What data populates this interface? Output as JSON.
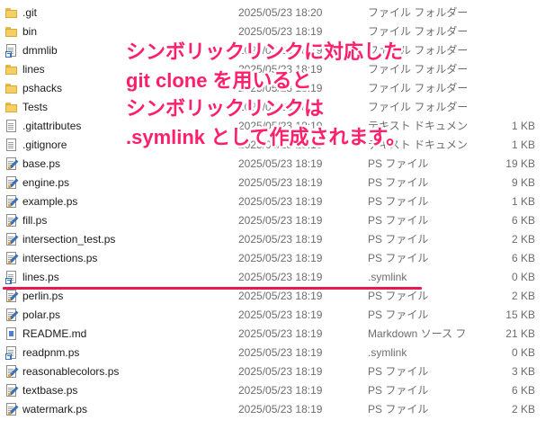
{
  "files": [
    {
      "name": ".git",
      "date": "2025/05/23 18:20",
      "type": "ファイル フォルダー",
      "size": "",
      "icon": "folder-icon"
    },
    {
      "name": "bin",
      "date": "2025/05/23 18:19",
      "type": "ファイル フォルダー",
      "size": "",
      "icon": "folder-icon"
    },
    {
      "name": "dmmlib",
      "date": "2025/05/23 18:19",
      "type": "ファイル フォルダー",
      "size": "",
      "icon": "symlink-file-icon"
    },
    {
      "name": "lines",
      "date": "2025/05/23 18:19",
      "type": "ファイル フォルダー",
      "size": "",
      "icon": "folder-icon"
    },
    {
      "name": "pshacks",
      "date": "2025/05/23 18:19",
      "type": "ファイル フォルダー",
      "size": "",
      "icon": "folder-icon"
    },
    {
      "name": "Tests",
      "date": "2025/05/23 18:19",
      "type": "ファイル フォルダー",
      "size": "",
      "icon": "folder-icon"
    },
    {
      "name": ".gitattributes",
      "date": "2025/05/23 18:19",
      "type": "テキスト ドキュメント",
      "size": "1 KB",
      "icon": "text-document-icon"
    },
    {
      "name": ".gitignore",
      "date": "2025/05/23 18:19",
      "type": "テキスト ドキュメント",
      "size": "1 KB",
      "icon": "text-document-icon"
    },
    {
      "name": "base.ps",
      "date": "2025/05/23 18:19",
      "type": "PS ファイル",
      "size": "19 KB",
      "icon": "ps-file-icon"
    },
    {
      "name": "engine.ps",
      "date": "2025/05/23 18:19",
      "type": "PS ファイル",
      "size": "9 KB",
      "icon": "ps-file-icon"
    },
    {
      "name": "example.ps",
      "date": "2025/05/23 18:19",
      "type": "PS ファイル",
      "size": "1 KB",
      "icon": "ps-file-icon"
    },
    {
      "name": "fill.ps",
      "date": "2025/05/23 18:19",
      "type": "PS ファイル",
      "size": "6 KB",
      "icon": "ps-file-icon"
    },
    {
      "name": "intersection_test.ps",
      "date": "2025/05/23 18:19",
      "type": "PS ファイル",
      "size": "2 KB",
      "icon": "ps-file-icon"
    },
    {
      "name": "intersections.ps",
      "date": "2025/05/23 18:19",
      "type": "PS ファイル",
      "size": "6 KB",
      "icon": "ps-file-icon"
    },
    {
      "name": "lines.ps",
      "date": "2025/05/23 18:19",
      "type": ".symlink",
      "size": "0 KB",
      "icon": "symlink-file-icon"
    },
    {
      "name": "perlin.ps",
      "date": "2025/05/23 18:19",
      "type": "PS ファイル",
      "size": "2 KB",
      "icon": "ps-file-icon"
    },
    {
      "name": "polar.ps",
      "date": "2025/05/23 18:19",
      "type": "PS ファイル",
      "size": "15 KB",
      "icon": "ps-file-icon"
    },
    {
      "name": "README.md",
      "date": "2025/05/23 18:19",
      "type": "Markdown ソース フ...",
      "size": "21 KB",
      "icon": "markdown-file-icon"
    },
    {
      "name": "readpnm.ps",
      "date": "2025/05/23 18:19",
      "type": ".symlink",
      "size": "0 KB",
      "icon": "symlink-file-icon"
    },
    {
      "name": "reasonablecolors.ps",
      "date": "2025/05/23 18:19",
      "type": "PS ファイル",
      "size": "3 KB",
      "icon": "ps-file-icon"
    },
    {
      "name": "textbase.ps",
      "date": "2025/05/23 18:19",
      "type": "PS ファイル",
      "size": "6 KB",
      "icon": "ps-file-icon"
    },
    {
      "name": "watermark.ps",
      "date": "2025/05/23 18:19",
      "type": "PS ファイル",
      "size": "2 KB",
      "icon": "ps-file-icon"
    }
  ],
  "annotation": {
    "lines": [
      "シンボリックリンクに対応した",
      "git clone を用いると",
      "シンボリックリンクは",
      ".symlink として作成されます。"
    ],
    "color": "#ff1f6a"
  },
  "highlight": {
    "color": "#e8194f"
  }
}
